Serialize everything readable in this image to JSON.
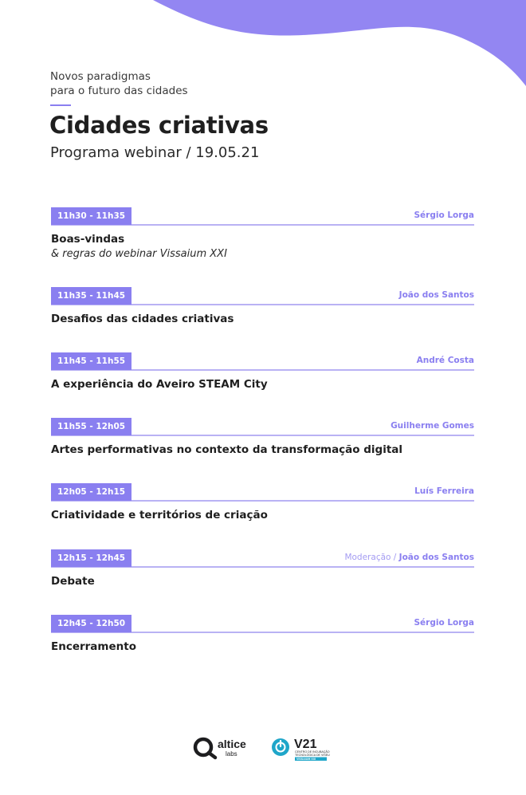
{
  "header": {
    "kicker_line1": "Novos paradigmas",
    "kicker_line2": "para o futuro das cidades",
    "title": "Cidades criativas",
    "subtitle": "Programa webinar / 19.05.21"
  },
  "colors": {
    "accent": "#8a7ff0",
    "rule": "#b9b2f4",
    "blob": "#9386f2"
  },
  "agenda": [
    {
      "time": "11h30 - 11h35",
      "speaker": "Sérgio Lorga",
      "title": "Boas-vindas",
      "subtitle": "& regras do webinar Vissaium XXI"
    },
    {
      "time": "11h35 - 11h45",
      "speaker": "João dos Santos",
      "title": "Desafios das cidades criativas"
    },
    {
      "time": "11h45 - 11h55",
      "speaker": "André Costa",
      "title": "A experiência do Aveiro STEAM City"
    },
    {
      "time": "11h55 - 12h05",
      "speaker": "Guilherme Gomes",
      "title": "Artes performativas no contexto da transformação digital"
    },
    {
      "time": "12h05 - 12h15",
      "speaker": "Luís Ferreira",
      "title": "Criatividade e territórios de criação"
    },
    {
      "time": "12h15 - 12h45",
      "speaker_prefix": "Moderação / ",
      "speaker": "João dos Santos",
      "title": "Debate"
    },
    {
      "time": "12h45 - 12h50",
      "speaker": "Sérgio Lorga",
      "title": "Encerramento"
    }
  ],
  "logos": {
    "altice_word": "altice",
    "altice_sub": "labs",
    "v21_word": "V21",
    "v21_desc_line1": "CENTRO DE INCUBAÇÃO",
    "v21_desc_line2": "TECNOLÓGICA DE VISEU",
    "v21_tag": "VISSAIUM XXI",
    "icons": [
      "altice-logo-icon",
      "v21-power-icon"
    ]
  }
}
